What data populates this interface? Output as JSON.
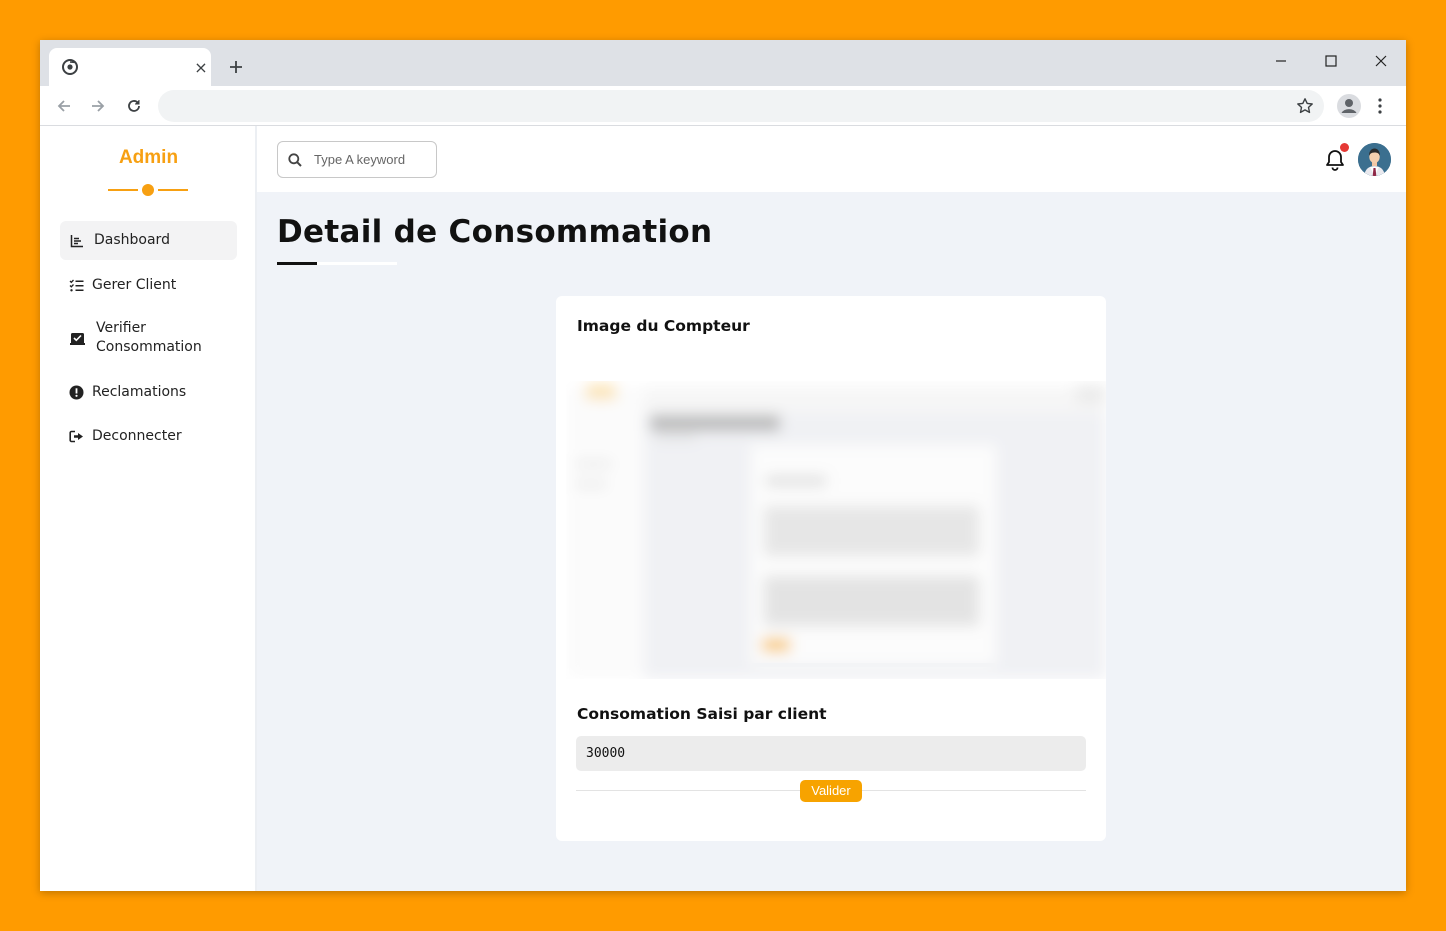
{
  "browser": {
    "tab_title": "",
    "tab_close": "×",
    "address": ""
  },
  "sidebar": {
    "brand": "Admin",
    "items": [
      {
        "label": "Dashboard",
        "icon": "chart-icon",
        "active": true
      },
      {
        "label": "Gerer Client",
        "icon": "tasks-icon",
        "active": false
      },
      {
        "label": "Verifier Consommation",
        "icon": "check-box-icon",
        "active": false
      },
      {
        "label": "Reclamations",
        "icon": "exclamation-circle-icon",
        "active": false
      },
      {
        "label": "Deconnecter",
        "icon": "sign-out-icon",
        "active": false
      }
    ]
  },
  "topbar": {
    "search_placeholder": "Type A keyword",
    "notification_dot_color": "#e53935"
  },
  "main": {
    "title": "Detail de Consommation",
    "card": {
      "image_heading": "Image du Compteur",
      "consumption_label": "Consomation Saisi par client",
      "consumption_value": "30000",
      "submit_label": "Valider"
    }
  },
  "colors": {
    "accent": "#f7a012",
    "button": "#f7a300",
    "background": "#ff9b00"
  }
}
